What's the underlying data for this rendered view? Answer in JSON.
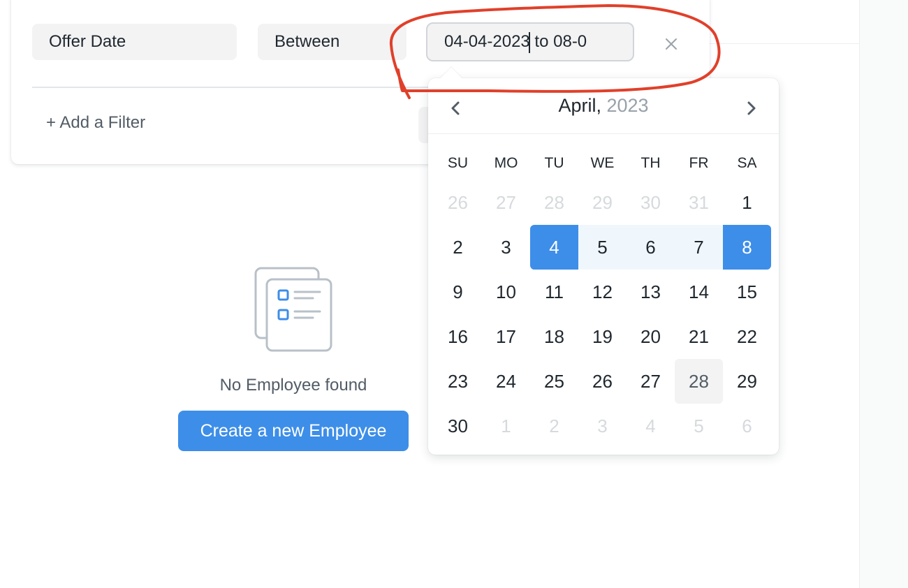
{
  "filter": {
    "field_label": "Offer Date",
    "condition_label": "Between",
    "value": "04-04-2023 to 08-0",
    "add_filter_label": "+ Add a Filter"
  },
  "calendar": {
    "month": "April,",
    "year": "2023",
    "weekdays": [
      "SU",
      "MO",
      "TU",
      "WE",
      "TH",
      "FR",
      "SA"
    ],
    "weeks": [
      [
        "26",
        "27",
        "28",
        "29",
        "30",
        "31",
        "1"
      ],
      [
        "2",
        "3",
        "4",
        "5",
        "6",
        "7",
        "8"
      ],
      [
        "9",
        "10",
        "11",
        "12",
        "13",
        "14",
        "15"
      ],
      [
        "16",
        "17",
        "18",
        "19",
        "20",
        "21",
        "22"
      ],
      [
        "23",
        "24",
        "25",
        "26",
        "27",
        "28",
        "29"
      ],
      [
        "30",
        "1",
        "2",
        "3",
        "4",
        "5",
        "6"
      ]
    ],
    "range_start": "4",
    "range_end": "8",
    "today": "28"
  },
  "empty_state": {
    "message": "No Employee found",
    "create_button_label": "Create a new Employee"
  },
  "colors": {
    "accent": "#3d8ee8",
    "range_fill": "#f0f7fc",
    "annotation": "#e0402a"
  },
  "icons": {
    "remove": "close-icon",
    "prev": "chevron-left-icon",
    "next": "chevron-right-icon",
    "empty": "list-document-icon"
  }
}
